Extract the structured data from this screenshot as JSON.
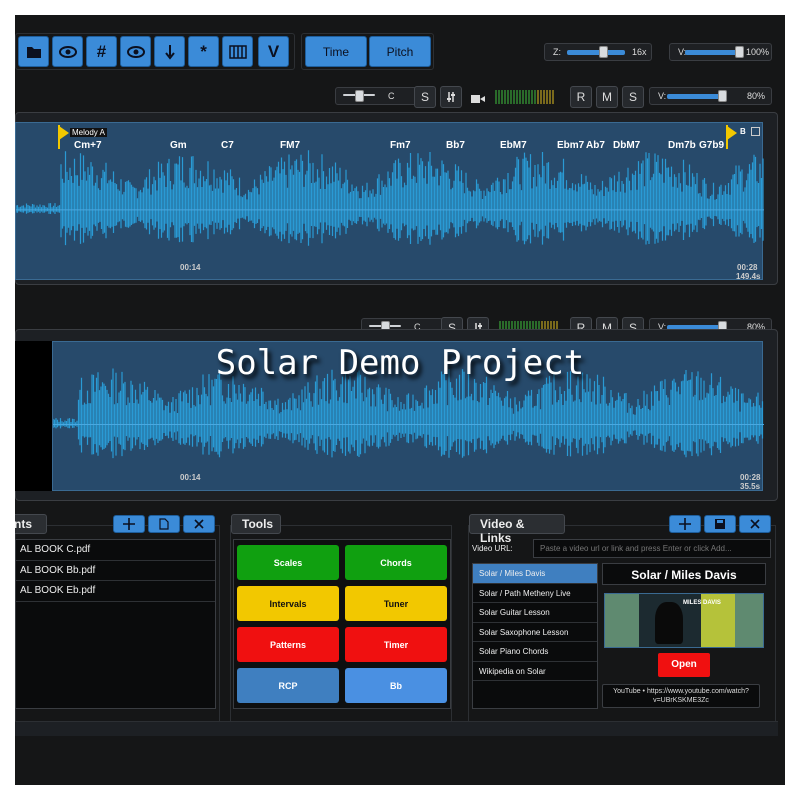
{
  "toolbar": {
    "tool_icons": [
      "folder-icon",
      "eye-icon",
      "hash-icon",
      "eye-icon",
      "arrow-down-icon",
      "asterisk-icon",
      "piano-icon",
      "v-icon"
    ],
    "hash_glyph": "#",
    "asterisk_glyph": "*",
    "v_glyph": "V",
    "time_label": "Time",
    "pitch_label": "Pitch",
    "zoom_label": "Z:",
    "zoom_value": "16x",
    "zoom_level": 0.6,
    "volume_label": "V:",
    "volume_value": "100%",
    "volume_level": 1.0
  },
  "track1": {
    "pitch_key": "C",
    "solo_label": "S",
    "mute_label": "M",
    "rec_label": "R",
    "volume_label": "V:",
    "volume_value": "80%",
    "volume_level": 0.8,
    "marker_label": "Melody A",
    "end_marker_label": "B",
    "chords": [
      "Cm+7",
      "Gm",
      "C7",
      "FM7",
      "Fm7",
      "Bb7",
      "EbM7",
      "Ebm7",
      "Ab7",
      "DbM7",
      "Dm7b",
      "G7b9"
    ],
    "time_mid": "00:14",
    "time_end": "00:28",
    "duration": "149.4s"
  },
  "track2": {
    "pitch_key": "C",
    "solo_label": "S",
    "mute_label": "M",
    "rec_label": "R",
    "volume_label": "V:",
    "volume_value": "80%",
    "volume_level": 0.8,
    "project_title": "Solar Demo Project",
    "time_mid": "00:14",
    "time_end": "00:28",
    "duration": "35.5s"
  },
  "documents": {
    "title": "nts",
    "files": [
      "AL BOOK C.pdf",
      "AL BOOK Bb.pdf",
      "AL BOOK Eb.pdf"
    ]
  },
  "tools": {
    "title": "Tools",
    "buttons": [
      {
        "label": "Scales",
        "color": "#10a010"
      },
      {
        "label": "Chords",
        "color": "#10a010"
      },
      {
        "label": "Intervals",
        "color": "#f2c800"
      },
      {
        "label": "Tuner",
        "color": "#f2c800"
      },
      {
        "label": "Patterns",
        "color": "#f01010"
      },
      {
        "label": "Timer",
        "color": "#f01010"
      },
      {
        "label": "RCP",
        "color": "#3f7fc0"
      },
      {
        "label": "Bb",
        "color": "#4a90e2"
      }
    ]
  },
  "video": {
    "title": "Video & Links",
    "url_label": "Video URL:",
    "url_placeholder": "Paste a video url or link and press Enter or click Add...",
    "items": [
      "Solar / Miles Davis",
      "Solar / Path Metheny Live",
      "Solar Guitar Lesson",
      "Solar Saxophone Lesson",
      "Solar Piano Chords",
      "Wikipedia on Solar"
    ],
    "selected_index": 0,
    "preview_title": "Solar / Miles Davis",
    "thumbnail_text": "MILES DAVIS",
    "open_label": "Open",
    "link_text": "YouTube • https://www.youtube.com/watch?v=UBrKSKME3Zc"
  },
  "colors": {
    "accent": "#3b8bd8",
    "waveform": "#2a9ad4",
    "marker": "#f2c800"
  }
}
